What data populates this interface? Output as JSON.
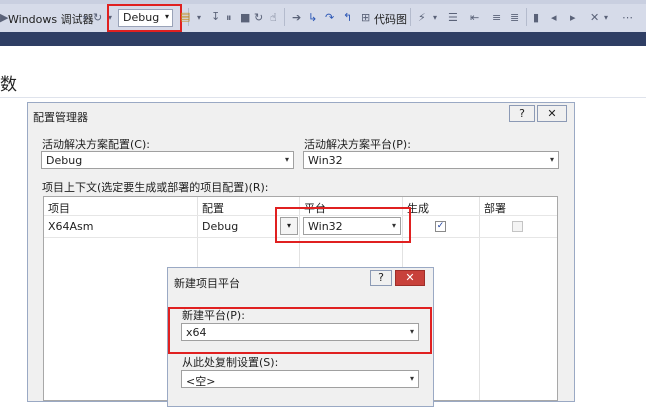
{
  "toolbar": {
    "windows_debugger": "Windows 调试器",
    "config_value": "Debug",
    "code_map": "代码图"
  },
  "page": {
    "heading": "数"
  },
  "config_manager": {
    "title": "配置管理器",
    "help_glyph": "?",
    "close_glyph": "✕",
    "solution_config_label": "活动解决方案配置(C):",
    "solution_config_value": "Debug",
    "solution_platform_label": "活动解决方案平台(P):",
    "solution_platform_value": "Win32",
    "contexts_label": "项目上下文(选定要生成或部署的项目配置)(R):",
    "columns": [
      "项目",
      "配置",
      "平台",
      "生成",
      "部署"
    ],
    "rows": [
      {
        "project": "X64Asm",
        "config": "Debug",
        "platform": "Win32",
        "build": true,
        "deploy": false
      }
    ]
  },
  "new_platform": {
    "title": "新建项目平台",
    "help_glyph": "?",
    "close_glyph": "✕",
    "platform_label": "新建平台(P):",
    "platform_value": "x64",
    "copy_label": "从此处复制设置(S):",
    "copy_value": "<空>"
  },
  "icons": {
    "dropdown": "▾",
    "check": "✓"
  },
  "colors": {
    "highlight_red": "#e02020",
    "toolbar_bg": "#d6dbe9",
    "dialog_bg": "#f0f0f0",
    "close_red": "#c8413b"
  }
}
